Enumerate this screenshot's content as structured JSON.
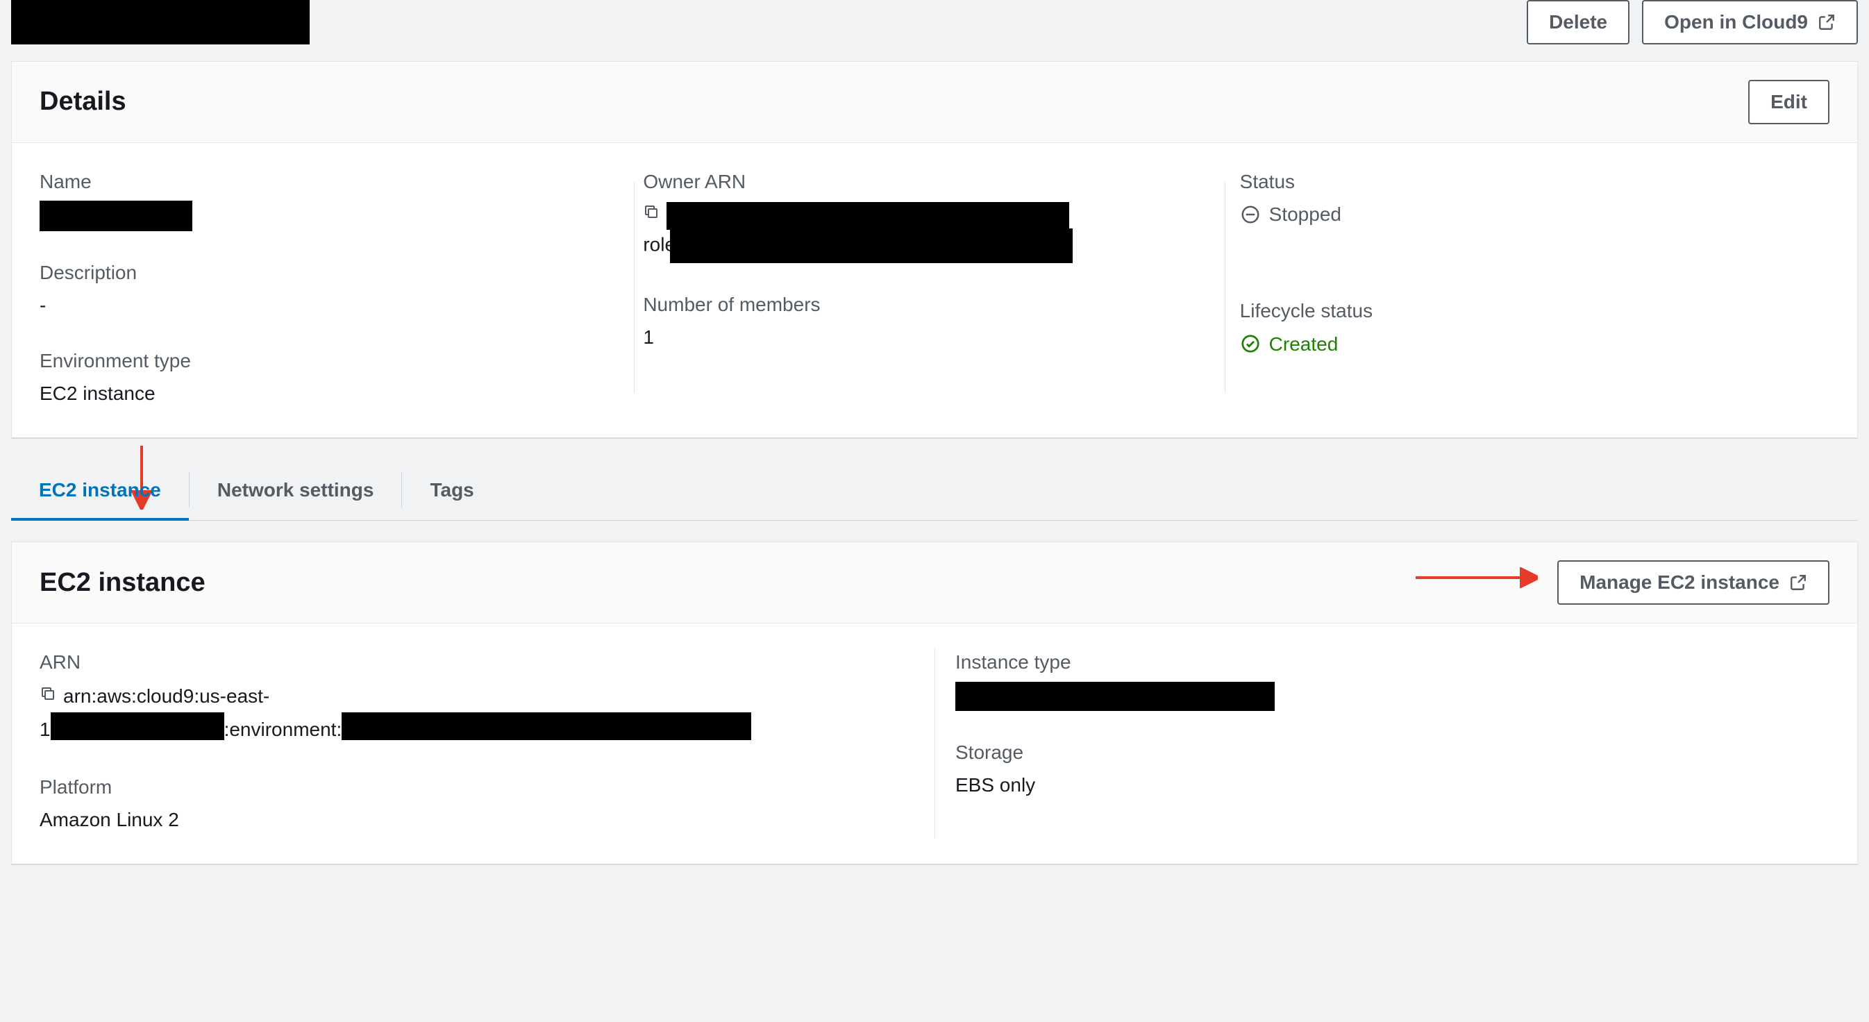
{
  "header": {
    "delete_label": "Delete",
    "open_cloud9_label": "Open in Cloud9"
  },
  "details": {
    "title": "Details",
    "edit_label": "Edit",
    "name_label": "Name",
    "description_label": "Description",
    "description_value": "-",
    "env_type_label": "Environment type",
    "env_type_value": "EC2 instance",
    "owner_arn_label": "Owner ARN",
    "owner_arn_line2_prefix": "role",
    "members_label": "Number of members",
    "members_value": "1",
    "status_label": "Status",
    "status_value": "Stopped",
    "lifecycle_label": "Lifecycle status",
    "lifecycle_value": "Created"
  },
  "tabs": {
    "ec2": "EC2 instance",
    "network": "Network settings",
    "tags": "Tags"
  },
  "ec2_panel": {
    "title": "EC2 instance",
    "manage_label": "Manage EC2 instance",
    "arn_label": "ARN",
    "arn_prefix": "arn:aws:cloud9:us-east-",
    "arn_line2_prefix": "1",
    "arn_line2_mid": ":environment:",
    "platform_label": "Platform",
    "platform_value": "Amazon Linux 2",
    "instance_type_label": "Instance type",
    "storage_label": "Storage",
    "storage_value": "EBS only"
  }
}
